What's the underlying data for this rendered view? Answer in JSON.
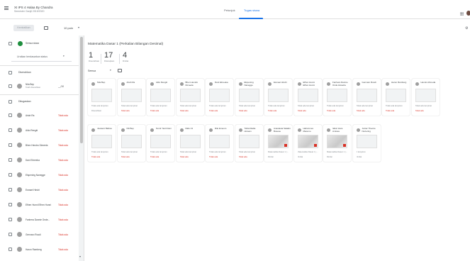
{
  "header": {
    "class_title": "XI IPS 4 Halaa By Chandra",
    "class_subtitle": "Semester Ganjil 2019/2020",
    "tabs": [
      {
        "label": "Petunjuk",
        "active": false
      },
      {
        "label": "Tugas siswa",
        "active": true
      }
    ],
    "icons": {
      "menu": "menu-icon",
      "apps": "apps-icon",
      "account": "avatar"
    }
  },
  "toolbar": {
    "return_label": "Kembalikan",
    "points_value": "10 poin",
    "icons": {
      "mail": "mail-icon",
      "caret": "chevron-down-icon",
      "settings": "gear-icon"
    }
  },
  "sidebar": {
    "all_students_label": "Semua siswa",
    "sort_label": "Urutkan berdasarkan status",
    "sections": {
      "returned": "Diserahkan",
      "assigned": "Ditugaskan"
    },
    "returned_students": [
      {
        "name": "Nila Bep",
        "sub": "Telah diserahkan",
        "status": "__/10"
      }
    ],
    "assigned_students": [
      {
        "name": "Ariah Ra",
        "status": "Tidak ada"
      },
      {
        "name": "Aldo Rengki",
        "status": "Tidak ada"
      },
      {
        "name": "Bhen Hendro Dimeela",
        "status": "Tidak ada"
      },
      {
        "name": "Dani Elmeeka",
        "status": "Tidak ada"
      },
      {
        "name": "Elspening Nanegge",
        "status": "Tidak ada"
      },
      {
        "name": "Esmael Hindri",
        "status": "Tidak ada"
      },
      {
        "name": "Efhen Hunni Efhen Hunni",
        "status": "Tidak ada"
      },
      {
        "name": "Fanhera Dannie Onde...",
        "status": "Tidak ada"
      },
      {
        "name": "Gennaro Rusdi",
        "status": "Tidak ada"
      },
      {
        "name": "Haron Ramberg",
        "status": "Tidak ada"
      }
    ]
  },
  "assignment": {
    "title": "Matematika Dasar 1 (Perkalian Bilangan Desimal)",
    "stats": [
      {
        "value": "1",
        "label": "Diserahkan"
      },
      {
        "value": "17",
        "label": "Ditetapkan"
      },
      {
        "value": "4",
        "label": "Dinilai"
      }
    ],
    "filter_label": "Semua",
    "icons": {
      "filter_caret": "chevron-down-icon",
      "folder": "folder-icon"
    }
  },
  "cards_row1": [
    {
      "name": "Nila Bep",
      "note": "Tidak ada lampiran",
      "status": "Diserahkan",
      "grey": true
    },
    {
      "name": "Ariah Ra",
      "note": "Tidak ada lampiran",
      "status": "Tidak ada",
      "grey": false
    },
    {
      "name": "Aldo Rengki",
      "note": "Tidak ada lampiran",
      "status": "Tidak ada",
      "grey": false
    },
    {
      "name": "Bhen Hendro Dimeela",
      "note": "Tidak ada lampiran",
      "status": "Tidak ada",
      "grey": false
    },
    {
      "name": "Dani Elmeeka",
      "note": "Tidak ada lampiran",
      "status": "Tidak ada",
      "grey": false
    },
    {
      "name": "Elspening Nanegge",
      "note": "Tidak ada lampiran",
      "status": "Tidak ada",
      "grey": false
    },
    {
      "name": "Esmael Hindri",
      "note": "Tidak ada lampiran",
      "status": "Tidak ada",
      "grey": false
    },
    {
      "name": "Efhen Hunni Efhen Hunni",
      "note": "Tidak ada lampiran",
      "status": "Tidak ada",
      "grey": false
    },
    {
      "name": "Fanhera Dannie Onde Hissehe",
      "note": "Tidak ada lampiran",
      "status": "Tidak ada",
      "grey": false
    },
    {
      "name": "Gennaro Rusdi",
      "note": "Tidak ada lampiran",
      "status": "Tidak ada",
      "grey": false
    },
    {
      "name": "Haron Ramberg",
      "note": "Tidak ada lampiran",
      "status": "Tidak ada",
      "grey": false
    },
    {
      "name": "Hendo Ahmeda",
      "note": "Tidak ada lampiran",
      "status": "Tidak ada",
      "grey": false
    }
  ],
  "cards_row2": [
    {
      "name": "Juwaeni Bahsie",
      "note": "Tidak ada lampiran",
      "status": "Tidak ada",
      "grey": false,
      "photo": false
    },
    {
      "name": "Nili Bep",
      "note": "Tidak ada lampiran",
      "status": "Tidak ada",
      "grey": false,
      "photo": false
    },
    {
      "name": "Nurul Yanti Dani",
      "note": "Tidak ada lampiran",
      "status": "Tidak ada",
      "grey": false,
      "photo": false
    },
    {
      "name": "Rafe 13",
      "note": "Tidak ada lampiran",
      "status": "Tidak ada",
      "grey": false,
      "photo": false
    },
    {
      "name": "Rile Emeum",
      "note": "Tidak ada lampiran",
      "status": "Tidak ada",
      "grey": false,
      "photo": false
    },
    {
      "name": "Tobia Radia Hinsam",
      "note": "Tidak ada lampiran",
      "status": "Tidak ada",
      "grey": false,
      "photo": false
    },
    {
      "name": "Anastasia Salakin Bosese",
      "note": "Matematika Dasar 1 (...",
      "status": "Dinilai",
      "grey": true,
      "photo": true
    },
    {
      "name": "Hahunmes Maremo",
      "note": "Matematika Dasar 1 (...",
      "status": "Dinilai",
      "grey": true,
      "photo": true
    },
    {
      "name": "Iahwi Hora Amissa",
      "note": "Matematika Dasar 1 (...",
      "status": "Dinilai",
      "grey": true,
      "photo": true
    },
    {
      "name": "Juniar Theorie Nurtering",
      "note": "2 lampiran",
      "status": "Dinilai",
      "grey": true,
      "photo": false
    }
  ]
}
